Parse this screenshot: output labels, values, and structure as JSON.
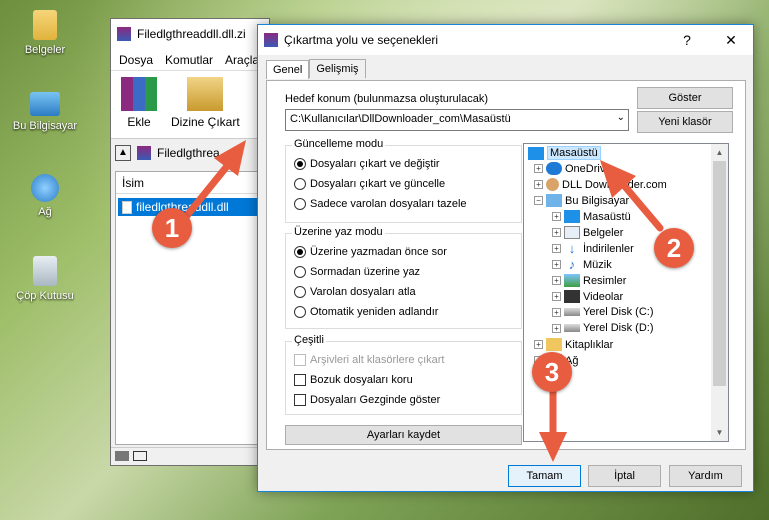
{
  "desktop": {
    "icons": [
      {
        "label": "Belgeler"
      },
      {
        "label": "Bu Bilgisayar"
      },
      {
        "label": "Ağ"
      },
      {
        "label": "Çöp Kutusu"
      }
    ]
  },
  "rar": {
    "title": "Filedlgthreaddll.dll.zi",
    "menu": [
      "Dosya",
      "Komutlar",
      "Araçla"
    ],
    "toolbar": {
      "add": "Ekle",
      "extract": "Dizine Çıkart"
    },
    "address": "Filedlgthrea",
    "column": "İsim",
    "file": "filedlgthreaddll.dll"
  },
  "dialog": {
    "title": "Çıkartma yolu ve seçenekleri",
    "tabs": [
      "Genel",
      "Gelişmiş"
    ],
    "dest_label": "Hedef konum (bulunmazsa oluşturulacak)",
    "dest_value": "C:\\Kullanıcılar\\DllDownloader_com\\Masaüstü",
    "show_btn": "Göster",
    "new_folder_btn": "Yeni klasör",
    "update_group": {
      "title": "Güncelleme modu",
      "options": [
        "Dosyaları çıkart ve değiştir",
        "Dosyaları çıkart ve güncelle",
        "Sadece varolan dosyaları tazele"
      ],
      "selected": 0
    },
    "overwrite_group": {
      "title": "Üzerine yaz modu",
      "options": [
        "Üzerine yazmadan önce sor",
        "Sormadan üzerine yaz",
        "Varolan dosyaları atla",
        "Otomatik yeniden adlandır"
      ],
      "selected": 0
    },
    "misc_group": {
      "title": "Çeşitli",
      "options": [
        "Arşivleri alt klasörlere çıkart",
        "Bozuk dosyaları koru",
        "Dosyaları Gezginde göster"
      ]
    },
    "save_btn": "Ayarları kaydet",
    "tree": [
      {
        "label": "Masaüstü",
        "icon": "desktop-icon"
      },
      {
        "label": "OneDrive",
        "icon": "cloud-icon"
      },
      {
        "label": "DLL Downloader.com",
        "icon": "user-icon"
      },
      {
        "label": "Bu Bilgisayar",
        "icon": "computer-icon"
      },
      {
        "label": "Masaüstü",
        "icon": "desktop-icon"
      },
      {
        "label": "Belgeler",
        "icon": "documents-icon"
      },
      {
        "label": "İndirilenler",
        "icon": "download-icon"
      },
      {
        "label": "Müzik",
        "icon": "music-icon"
      },
      {
        "label": "Resimler",
        "icon": "pictures-icon"
      },
      {
        "label": "Videolar",
        "icon": "videos-icon"
      },
      {
        "label": "Yerel Disk (C:)",
        "icon": "drive-icon"
      },
      {
        "label": "Yerel Disk (D:)",
        "icon": "drive-icon"
      },
      {
        "label": "Kitaplıklar",
        "icon": "library-icon"
      },
      {
        "label": "Ağ",
        "icon": "network-icon"
      }
    ],
    "ok_btn": "Tamam",
    "cancel_btn": "İptal",
    "help_btn": "Yardım"
  },
  "annotations": {
    "one": "1",
    "two": "2",
    "three": "3",
    "color": "#e85c3f"
  }
}
